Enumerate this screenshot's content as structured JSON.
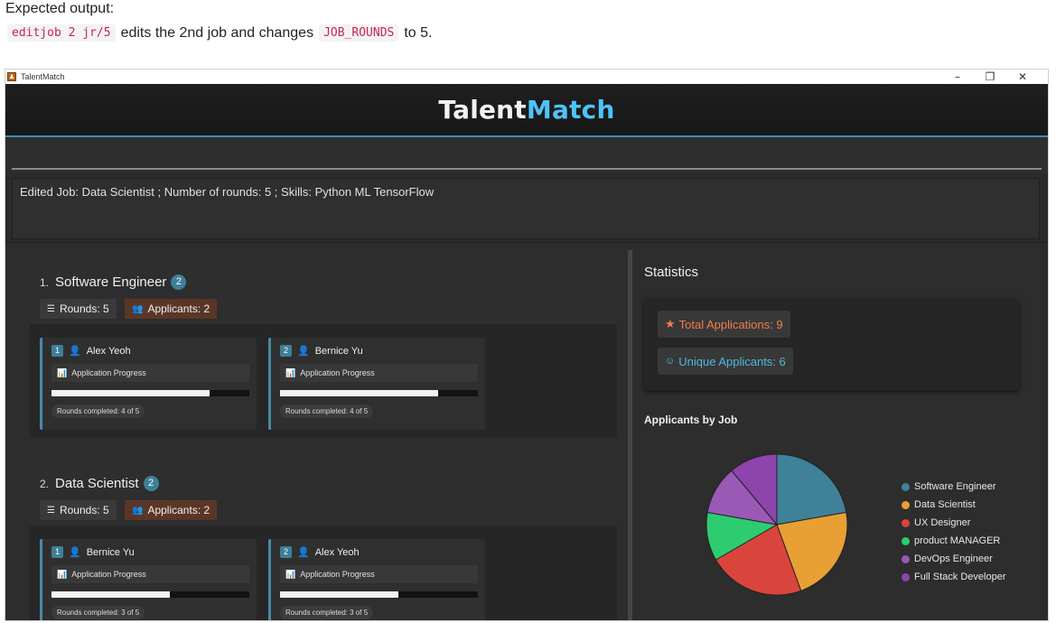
{
  "doc": {
    "heading": "Expected output:",
    "command": "editjob 2 jr/5",
    "text_mid": "edits the 2nd job and changes",
    "field": "JOB_ROUNDS",
    "text_end": "to 5."
  },
  "window": {
    "title": "TalentMatch",
    "minimize": "–",
    "restore": "❐",
    "close": "✕"
  },
  "brand": {
    "part1": "Talent",
    "part2": "Match"
  },
  "command_box": {
    "value": ""
  },
  "result": "Edited Job: Data Scientist ; Number of rounds: 5 ; Skills: Python ML TensorFlow",
  "jobs": [
    {
      "index": "1.",
      "title": "Software Engineer",
      "count": "2",
      "rounds_label": "Rounds: 5",
      "applicants_label": "Applicants: 2",
      "applicants": [
        {
          "index": "1",
          "name": "Alex Yeoh",
          "progress_label": "Application Progress",
          "progress": 0.8,
          "rounds_text": "Rounds completed: 4 of 5"
        },
        {
          "index": "2",
          "name": "Bernice Yu",
          "progress_label": "Application Progress",
          "progress": 0.8,
          "rounds_text": "Rounds completed: 4 of 5"
        }
      ]
    },
    {
      "index": "2.",
      "title": "Data Scientist",
      "count": "2",
      "rounds_label": "Rounds: 5",
      "applicants_label": "Applicants: 2",
      "applicants": [
        {
          "index": "1",
          "name": "Bernice Yu",
          "progress_label": "Application Progress",
          "progress": 0.6,
          "rounds_text": "Rounds completed: 3 of 5"
        },
        {
          "index": "2",
          "name": "Alex Yeoh",
          "progress_label": "Application Progress",
          "progress": 0.6,
          "rounds_text": "Rounds completed: 3 of 5"
        }
      ]
    }
  ],
  "stats": {
    "title": "Statistics",
    "total": "Total Applications: 9",
    "unique": "Unique Applicants: 6",
    "chart_title": "Applicants by Job"
  },
  "chart_data": {
    "type": "pie",
    "title": "Applicants by Job",
    "categories": [
      "Software Engineer",
      "Data Scientist",
      "UX Designer",
      "product MANAGER",
      "DevOps Engineer",
      "Full Stack Developer"
    ],
    "values": [
      2,
      2,
      2,
      1,
      1,
      1
    ],
    "colors": [
      "#3f8199",
      "#e8a035",
      "#d9453c",
      "#2ecc71",
      "#9b59b6",
      "#8e44ad"
    ],
    "legend": "right"
  }
}
